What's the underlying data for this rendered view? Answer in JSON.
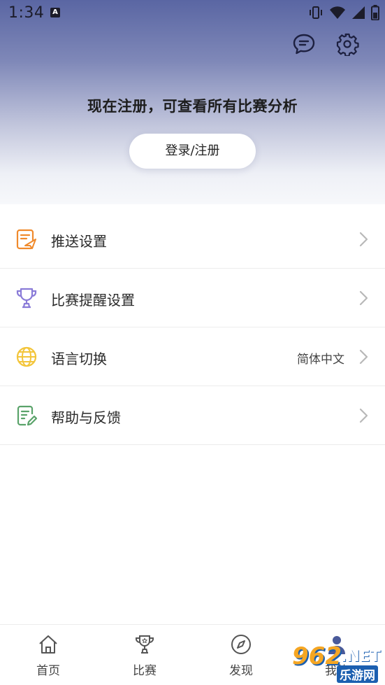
{
  "status_bar": {
    "time": "1:34",
    "notification_badge": "A",
    "icons": [
      "vibrate-icon",
      "wifi-icon",
      "signal-icon",
      "battery-icon"
    ]
  },
  "header": {
    "icons": [
      "message-icon",
      "gear-icon"
    ],
    "promo_text": "现在注册，可查看所有比赛分析",
    "login_label": "登录/注册"
  },
  "menu": {
    "items": [
      {
        "label": "推送设置",
        "icon": "push-settings-icon",
        "value": ""
      },
      {
        "label": "比赛提醒设置",
        "icon": "trophy-icon",
        "value": ""
      },
      {
        "label": "语言切换",
        "icon": "globe-icon",
        "value": "简体中文"
      },
      {
        "label": "帮助与反馈",
        "icon": "feedback-icon",
        "value": ""
      }
    ]
  },
  "tabbar": {
    "tabs": [
      {
        "label": "首页",
        "icon": "home-icon"
      },
      {
        "label": "比赛",
        "icon": "trophy-tab-icon"
      },
      {
        "label": "发现",
        "icon": "compass-icon"
      },
      {
        "label": "我的",
        "icon": "profile-icon"
      }
    ]
  },
  "watermark": {
    "number": "962",
    "suffix": ".NET",
    "site": "乐游网"
  },
  "colors": {
    "header_top": "#5a66a3",
    "orange_icon": "#f08a2c",
    "purple_icon": "#8a7bd8",
    "yellow_icon": "#f3c53a",
    "green_icon": "#5aa36a",
    "chevron": "#b8b8b8"
  }
}
